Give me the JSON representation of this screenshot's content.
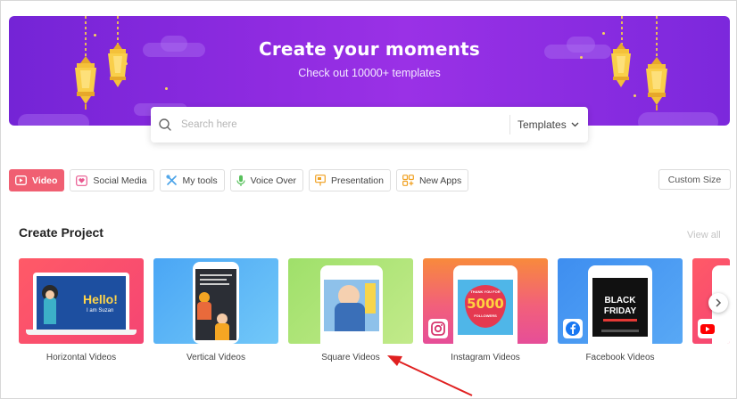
{
  "banner": {
    "title": "Create your moments",
    "subtitle": "Check out 10000+ templates"
  },
  "search": {
    "placeholder": "Search here",
    "dropdown_label": "Templates"
  },
  "tabs": [
    {
      "label": "Video",
      "icon": "play-icon",
      "active": true
    },
    {
      "label": "Social Media",
      "icon": "heart-icon"
    },
    {
      "label": "My tools",
      "icon": "tools-icon"
    },
    {
      "label": "Voice Over",
      "icon": "microphone-icon"
    },
    {
      "label": "Presentation",
      "icon": "presentation-icon"
    },
    {
      "label": "New Apps",
      "icon": "apps-icon"
    }
  ],
  "custom_size": "Custom Size",
  "section": {
    "title": "Create Project",
    "view_all": "View all"
  },
  "cards": [
    {
      "label": "Horizontal Videos",
      "preview_text": {
        "greeting": "Hello!",
        "name": "I am Suzan"
      }
    },
    {
      "label": "Vertical Videos"
    },
    {
      "label": "Square Videos"
    },
    {
      "label": "Instagram Videos",
      "preview_text": {
        "top": "THANK YOU FOR",
        "number": "5000",
        "bottom": "FOLLOWERS"
      }
    },
    {
      "label": "Facebook Videos",
      "preview_text": {
        "line1": "BLACK",
        "line2": "FRIDAY"
      }
    }
  ],
  "colors": {
    "accent": "#f05f72",
    "banner_start": "#7424d6",
    "banner_mid": "#9a31e6"
  }
}
